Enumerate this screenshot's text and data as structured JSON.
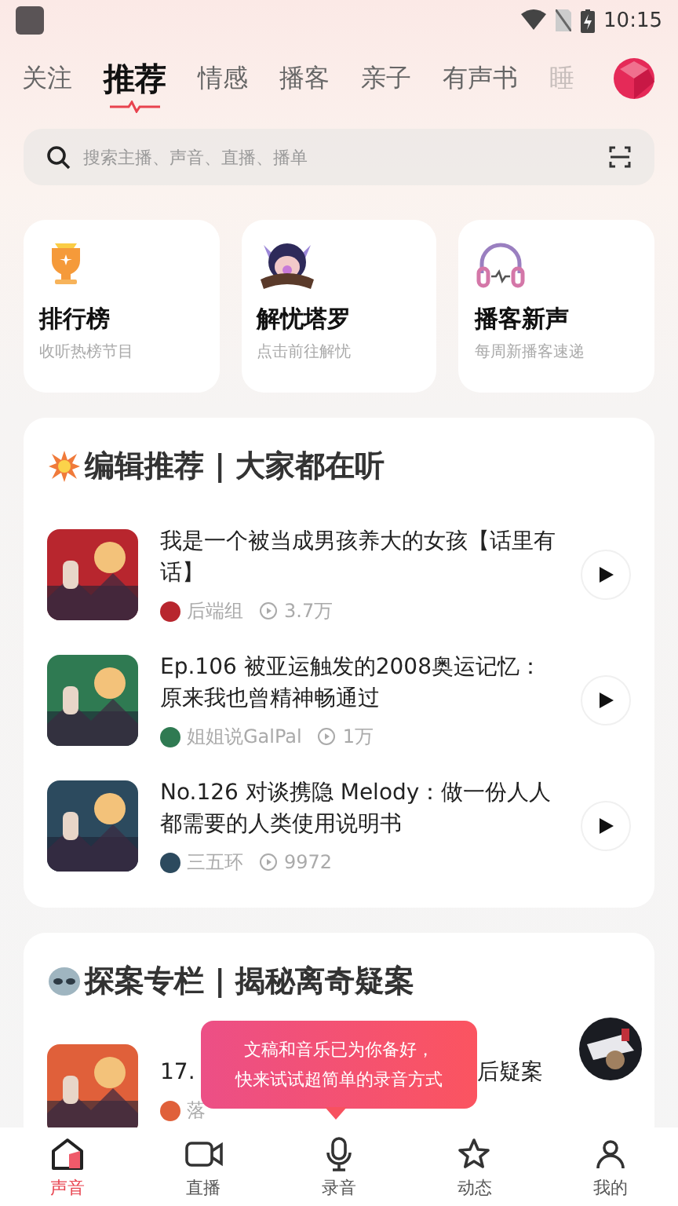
{
  "status_bar": {
    "time": "10:15"
  },
  "tabs": [
    {
      "label": "关注",
      "selected": false
    },
    {
      "label": "推荐",
      "selected": true
    },
    {
      "label": "情感",
      "selected": false
    },
    {
      "label": "播客",
      "selected": false
    },
    {
      "label": "亲子",
      "selected": false
    },
    {
      "label": "有声书",
      "selected": false
    },
    {
      "label": "睡",
      "selected": false
    }
  ],
  "search": {
    "placeholder": "搜索主播、声音、直播、播单"
  },
  "shortcuts": [
    {
      "kind": "trophy",
      "title": "排行榜",
      "subtitle": "收听热榜节目"
    },
    {
      "kind": "tarot",
      "title": "解忧塔罗",
      "subtitle": "点击前往解忧"
    },
    {
      "kind": "headphones",
      "title": "播客新声",
      "subtitle": "每周新播客速递"
    }
  ],
  "sections": [
    {
      "kind": "burst",
      "title": "编辑推荐 | 大家都在听",
      "items": [
        {
          "title": "我是一个被当成男孩养大的女孩【话里有话】",
          "author": "后端组",
          "plays": "3.7万"
        },
        {
          "title": "Ep.106  被亚运触发的2008奥运记忆：原来我也曾精神畅通过",
          "author": "姐姐说GalPal",
          "plays": "1万"
        },
        {
          "title": "No.126 对谈携隐 Melody：做一份人人都需要的人类使用说明书",
          "author": "三五环",
          "plays": "9972"
        }
      ]
    },
    {
      "kind": "alien",
      "title": "探案专栏 | 揭秘离奇疑案",
      "items": [
        {
          "title": "17.",
          "title_end": "后疑案",
          "author": "落"
        }
      ]
    }
  ],
  "tooltip": {
    "lines": [
      "文稿和音乐已为你备好，",
      "快来试试超简单的录音方式"
    ]
  },
  "nav": [
    {
      "kind": "home",
      "label": "声音",
      "selected": true
    },
    {
      "kind": "live",
      "label": "直播",
      "selected": false
    },
    {
      "kind": "mic",
      "label": "录音",
      "selected": false
    },
    {
      "kind": "star",
      "label": "动态",
      "selected": false
    },
    {
      "kind": "user",
      "label": "我的",
      "selected": false
    }
  ]
}
